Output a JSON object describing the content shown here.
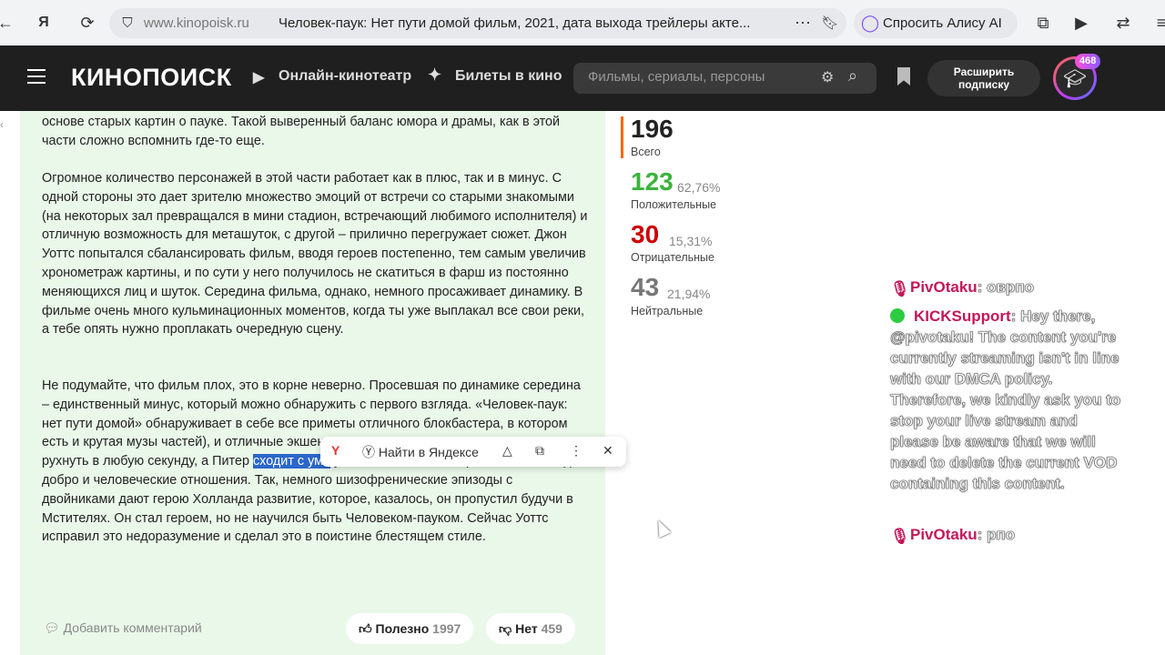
{
  "browser": {
    "domain": "www.kinopoisk.ru",
    "title": "Человек-паук: Нет пути домой фильм, 2021, дата выхода трейлеры акте...",
    "alice": "Спросить Алису AI"
  },
  "header": {
    "logo": "КИНОПОИСК",
    "nav_online": "Онлайн-кинотеатр",
    "nav_tickets": "Билеты в кино",
    "search_placeholder": "Фильмы, сериалы, персоны",
    "subscribe": "Расширить подписку",
    "badge": "468"
  },
  "review": {
    "p1": "основе старых картин о пауке. Такой выверенный баланс юмора и драмы, как в этой части сложно вспомнить где-то еще.",
    "p2": "Огромное количество персонажей в этой части работает как в плюс, так и в минус. С одной стороны это дает зрителю множество эмоций от встречи со старыми знакомыми (на некоторых зал превращался в мини стадион, встречающий любимого исполнителя) и отличную возможность для меташуток, с другой – прилично перегружает сюжет. Джон Уоттс попытался сбалансировать фильм, вводя героев постепенно, тем самым увеличив хронометраж картины, и по сути у него получилось не скатиться в фарш из постоянно меняющихся лиц и шуток. Середина фильма, однако, немного просаживает динамику. В фильме очень много кульминационных моментов, когда ты уже выплакал все свои реки, а тебе опять нужно проплакать очередную сцену.",
    "p3a": "Не подумайте, что фильм плох, это в корне неверно. Просевшая по динамике середина – единственный минус, который можно обнаружить с первого взгляда. «Человек-паук: нет пути домой» обнаруживает в себе все приметы отличного блокбастера, в котором есть и крутая музы",
    "p3b": "частей), и отличные экшен-сцены, и самое ",
    "p3c": "котором мир может рухнуть в любую секунду, а Питер ",
    "p3_selected": "сходит с ума",
    "p3d": " у нас на глазах, на первый план выводит добро и человеческие отношения. Так, немного шизофренические эпизоды с двойниками дают герою Холланда развитие, которое, казалось, он пропустил будучи в Мстителях. Он стал героем, но не научился быть Человеком-пауком. Сейчас Уоттс исправил это недоразумение и сделал это в поистине блестящем стиле.",
    "add_comment": "Добавить комментарий",
    "useful_label": "Полезно",
    "useful_count": "1997",
    "no_label": "Нет",
    "no_count": "459"
  },
  "popup": {
    "find": "Найти в Яндексе"
  },
  "stats": {
    "total": "196",
    "total_label": "Всего",
    "positive": "123",
    "positive_pct": "62,76%",
    "positive_label": "Положительные",
    "negative": "30",
    "negative_pct": "15,31%",
    "negative_label": "Отрицательные",
    "neutral": "43",
    "neutral_pct": "21,94%",
    "neutral_label": "Нейтральные",
    "colors": {
      "positive": "#3bb33b",
      "negative": "#cc0000",
      "neutral": "#777777",
      "accent": "#ff6600"
    }
  },
  "chat": {
    "m1_user": "PivOtaku",
    "m1_text": "оврпо",
    "m2_user": "KICKSupport",
    "m2_text": "Hey there, @pivotaku! The content you're currently streaming isn't in line with our DMCA policy. Therefore, we kindly ask you to stop your live stream and please be aware that we will need to delete the current VOD containing this content.",
    "m3_user": "PivOtaku",
    "m3_text": "рпо"
  }
}
